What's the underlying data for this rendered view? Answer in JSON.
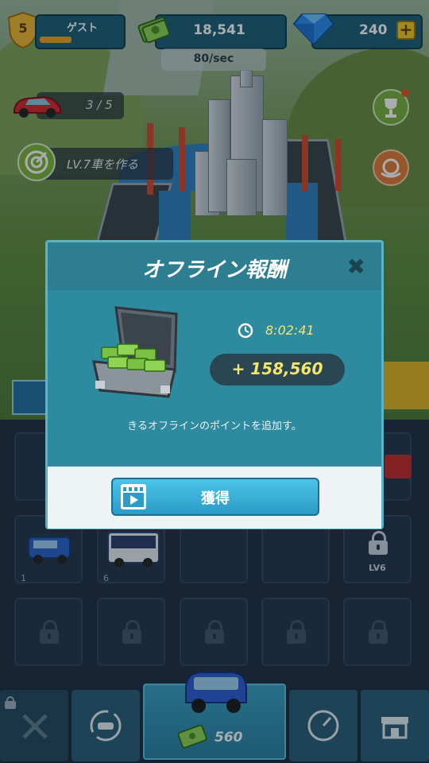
{
  "hud": {
    "level": "5",
    "player_name": "ゲスト",
    "money": "18,541",
    "income_rate": "80/sec",
    "gems": "240",
    "gems_add_symbol": "+"
  },
  "quests": {
    "car_count": "3 / 5",
    "goal_text": "LV.7車を作る"
  },
  "modal": {
    "title": "オフライン報酬",
    "close_symbol": "✖",
    "time": "8:02:41",
    "reward": "+ 158,560",
    "description": "きるオフラインのポイントを追加す。",
    "get_button_label": "獲得"
  },
  "slots": [
    {
      "number": "1"
    },
    {
      "number": "6"
    },
    {
      "lock_level": "LV6"
    }
  ],
  "bottom_nav": {
    "buy_price": "560"
  },
  "colors": {
    "accent": "#2a9cc7",
    "modal_bg": "#2f8aa0",
    "reward_text": "#f5e56b",
    "level_badge": "#f2b731"
  },
  "icons": [
    "shield-level-icon",
    "cash-icon",
    "diamond-icon",
    "plus-icon",
    "red-car-icon",
    "target-icon",
    "trophy-icon",
    "camera-map-icon",
    "close-icon",
    "clock-icon",
    "money-suitcase-icon",
    "video-icon",
    "lock-icon",
    "wrench-icon",
    "car-cycle-icon",
    "speedometer-icon",
    "shop-icon"
  ]
}
